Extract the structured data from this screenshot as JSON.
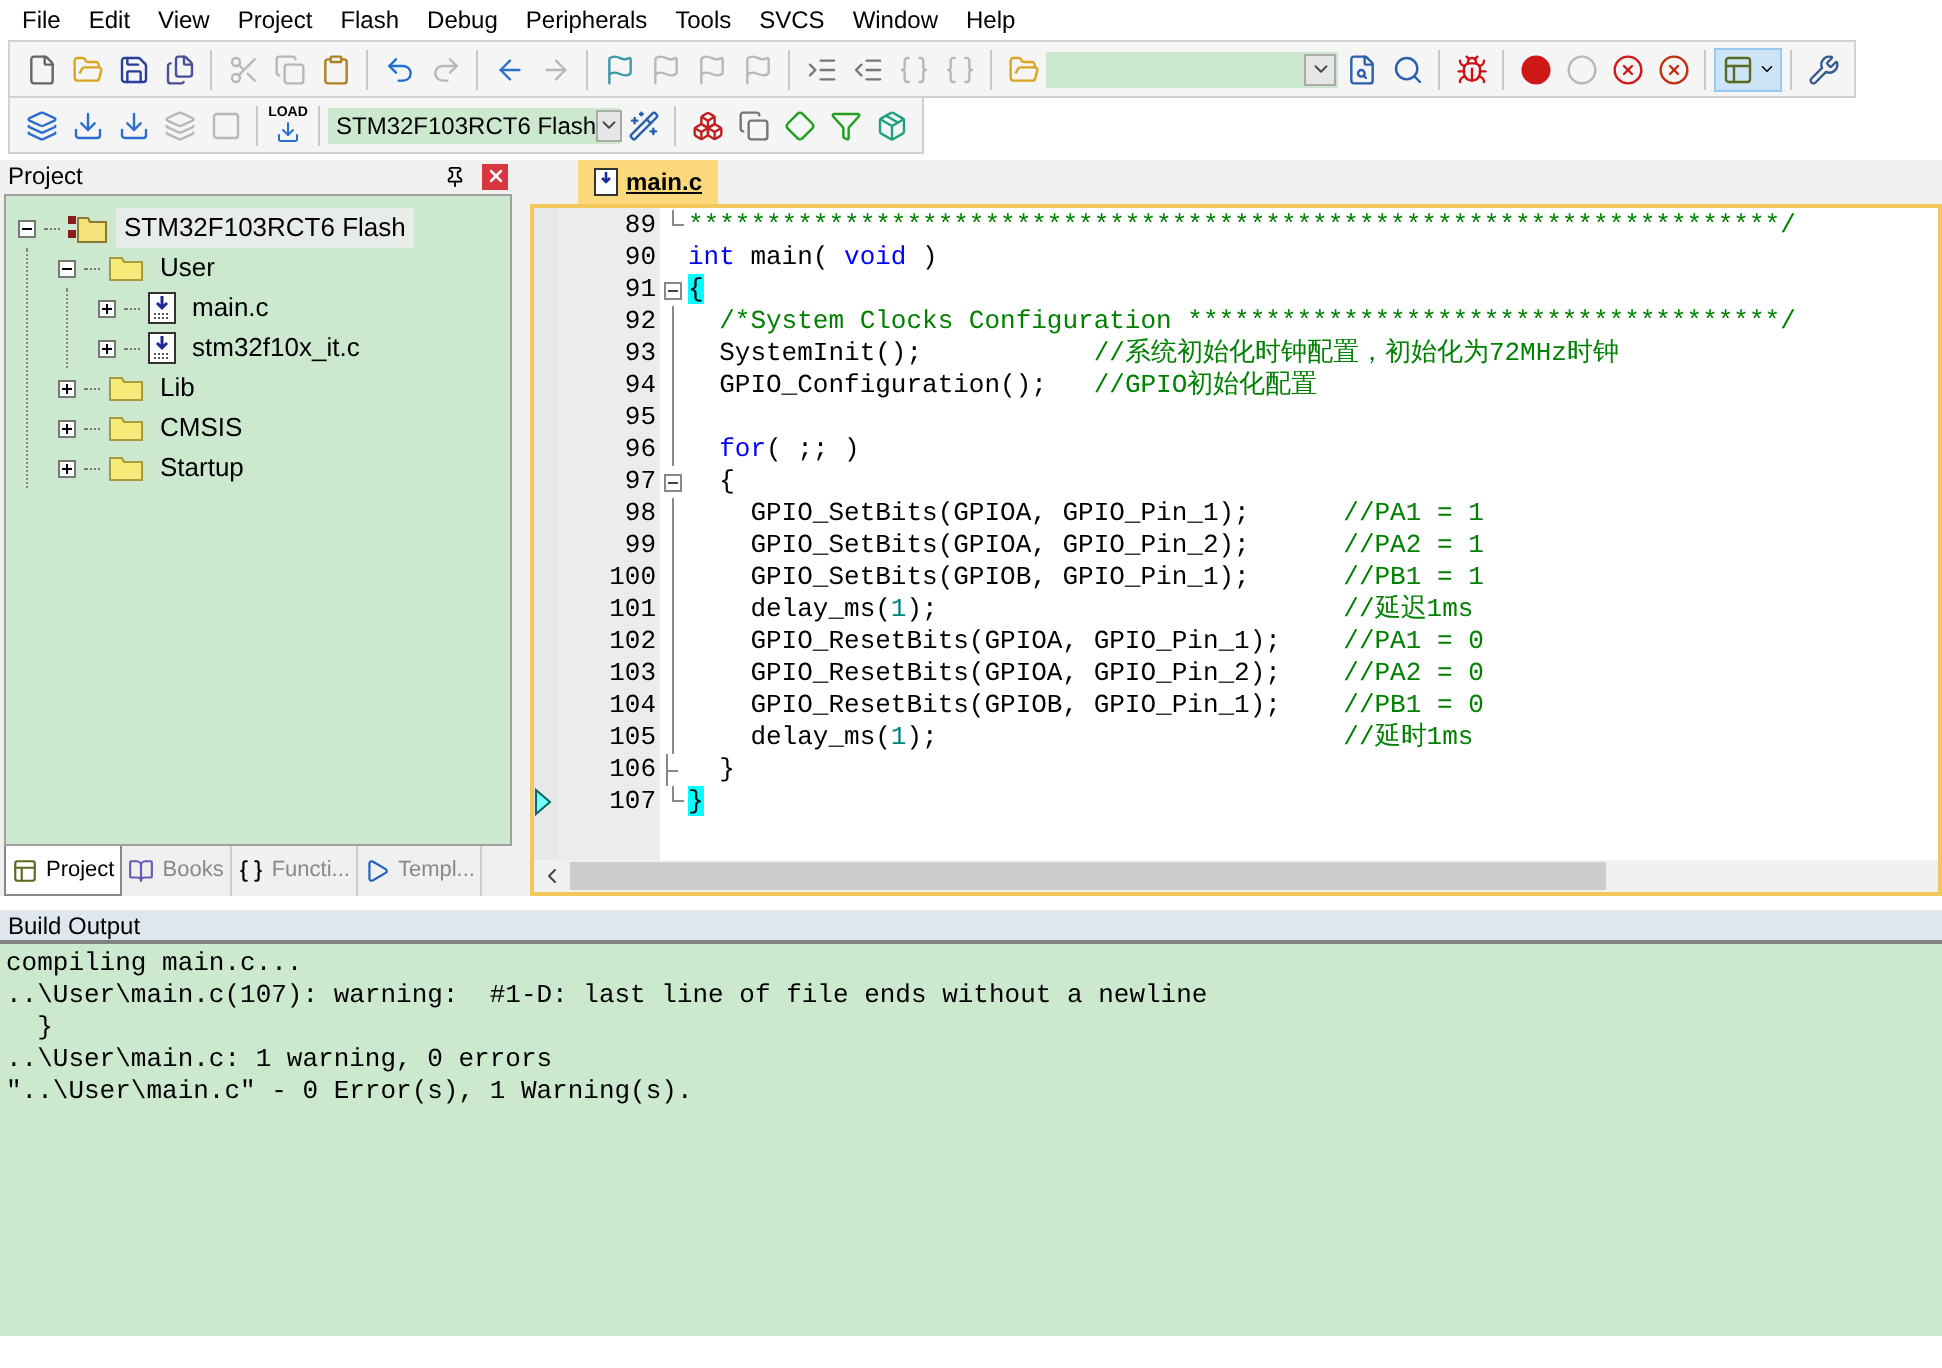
{
  "menu": [
    "File",
    "Edit",
    "View",
    "Project",
    "Flash",
    "Debug",
    "Peripherals",
    "Tools",
    "SVCS",
    "Window",
    "Help"
  ],
  "toolbar_1": [
    {
      "kind": "new",
      "disabled": false
    },
    {
      "kind": "open",
      "disabled": false
    },
    {
      "kind": "save",
      "disabled": false
    },
    {
      "kind": "save_all",
      "disabled": false
    },
    {
      "kind": "separator"
    },
    {
      "kind": "cut",
      "disabled": true
    },
    {
      "kind": "copy",
      "disabled": true
    },
    {
      "kind": "paste",
      "disabled": false
    },
    {
      "kind": "separator"
    },
    {
      "kind": "undo",
      "disabled": false
    },
    {
      "kind": "redo",
      "disabled": true
    },
    {
      "kind": "separator"
    },
    {
      "kind": "back",
      "disabled": false
    },
    {
      "kind": "forward",
      "disabled": true
    },
    {
      "kind": "separator"
    },
    {
      "kind": "bookmark",
      "disabled": false
    },
    {
      "kind": "prev_bookmark",
      "disabled": true
    },
    {
      "kind": "next_bookmark",
      "disabled": true
    },
    {
      "kind": "clear_bookmarks",
      "disabled": true
    },
    {
      "kind": "separator"
    },
    {
      "kind": "indent",
      "disabled": false
    },
    {
      "kind": "unindent",
      "disabled": false
    },
    {
      "kind": "comment",
      "disabled": true
    },
    {
      "kind": "uncomment",
      "disabled": true
    },
    {
      "kind": "separator"
    },
    {
      "kind": "find_in_files",
      "disabled": false
    },
    {
      "kind": "find_combo"
    },
    {
      "kind": "find",
      "disabled": false
    },
    {
      "kind": "incremental_find",
      "disabled": false
    },
    {
      "kind": "separator"
    },
    {
      "kind": "debug",
      "disabled": false
    },
    {
      "kind": "separator"
    },
    {
      "kind": "breakpoint",
      "disabled": false
    },
    {
      "kind": "disable_breakpoint",
      "disabled": true
    },
    {
      "kind": "disable_all",
      "disabled": false
    },
    {
      "kind": "kill_all",
      "disabled": false
    },
    {
      "kind": "separator"
    },
    {
      "kind": "window",
      "disabled": false
    },
    {
      "kind": "separator"
    },
    {
      "kind": "configure",
      "disabled": false
    }
  ],
  "toolbar_2": [
    {
      "kind": "translate",
      "disabled": false
    },
    {
      "kind": "build",
      "disabled": false
    },
    {
      "kind": "rebuild",
      "disabled": false
    },
    {
      "kind": "batch",
      "disabled": true
    },
    {
      "kind": "stop",
      "disabled": true
    },
    {
      "kind": "separator"
    },
    {
      "kind": "load",
      "disabled": false,
      "label": "LOAD"
    },
    {
      "kind": "separator"
    },
    {
      "kind": "target_combo",
      "value": "STM32F103RCT6 Flash"
    },
    {
      "kind": "options",
      "disabled": false
    },
    {
      "kind": "separator"
    },
    {
      "kind": "components",
      "disabled": false
    },
    {
      "kind": "environment",
      "disabled": false
    },
    {
      "kind": "packs",
      "disabled": false
    },
    {
      "kind": "filter",
      "disabled": false
    },
    {
      "kind": "multi",
      "disabled": false
    }
  ],
  "project_panel": {
    "title": "Project",
    "tree": [
      {
        "label": "STM32F103RCT6 Flash",
        "kind": "target",
        "expanded": true,
        "selected": true,
        "children": [
          {
            "label": "User",
            "kind": "folder",
            "expanded": true,
            "selected": false,
            "children": [
              {
                "label": "main.c",
                "kind": "file",
                "expanded": false,
                "selected": false
              },
              {
                "label": "stm32f10x_it.c",
                "kind": "file",
                "expanded": false,
                "selected": false
              }
            ]
          },
          {
            "label": "Lib",
            "kind": "folder",
            "expanded": false,
            "selected": false
          },
          {
            "label": "CMSIS",
            "kind": "folder",
            "expanded": false,
            "selected": false
          },
          {
            "label": "Startup",
            "kind": "folder",
            "expanded": false,
            "selected": false
          }
        ]
      }
    ],
    "tabs": [
      {
        "label": "Project",
        "kind": "project",
        "selected": true
      },
      {
        "label": "Books",
        "kind": "books",
        "selected": false
      },
      {
        "label": "Functi...",
        "kind": "functions",
        "selected": false
      },
      {
        "label": "Templ...",
        "kind": "templates",
        "selected": false
      }
    ]
  },
  "editor": {
    "tabs": [
      {
        "label": "main.c",
        "selected": true
      }
    ],
    "lines": [
      {
        "no": "89",
        "fold": {
          "kind": "end"
        },
        "current": false,
        "segments": [
          {
            "kind": "comment",
            "text": "**********************************************************************/"
          }
        ]
      },
      {
        "no": "90",
        "fold": {
          "kind": "none"
        },
        "current": false,
        "segments": [
          {
            "kind": "keyword",
            "text": "int"
          },
          {
            "kind": "plain",
            "text": " main( "
          },
          {
            "kind": "keyword",
            "text": "void"
          },
          {
            "kind": "plain",
            "text": " )"
          }
        ]
      },
      {
        "no": "91",
        "fold": {
          "kind": "open"
        },
        "current": false,
        "segments": [
          {
            "kind": "brace_match",
            "text": "{"
          }
        ]
      },
      {
        "no": "92",
        "fold": {
          "kind": "line"
        },
        "current": false,
        "segments": [
          {
            "kind": "comment",
            "text": "  /*System Clocks Configuration **************************************/"
          }
        ]
      },
      {
        "no": "93",
        "fold": {
          "kind": "line"
        },
        "current": false,
        "segments": [
          {
            "kind": "plain",
            "text": "  SystemInit();           "
          },
          {
            "kind": "comment",
            "text": "//系统初始化时钟配置，初始化为72MHz时钟"
          }
        ]
      },
      {
        "no": "94",
        "fold": {
          "kind": "line"
        },
        "current": false,
        "segments": [
          {
            "kind": "plain",
            "text": "  GPIO_Configuration();   "
          },
          {
            "kind": "comment",
            "text": "//GPIO初始化配置"
          }
        ]
      },
      {
        "no": "95",
        "fold": {
          "kind": "line"
        },
        "current": false
      },
      {
        "no": "96",
        "fold": {
          "kind": "line"
        },
        "current": false,
        "segments": [
          {
            "kind": "keyword",
            "text": "  for"
          },
          {
            "kind": "plain",
            "text": "( ;; )"
          }
        ]
      },
      {
        "no": "97",
        "fold": {
          "kind": "open"
        },
        "current": false,
        "segments": [
          {
            "kind": "plain",
            "text": "  {"
          }
        ]
      },
      {
        "no": "98",
        "fold": {
          "kind": "line"
        },
        "current": false,
        "segments": [
          {
            "kind": "plain",
            "text": "    GPIO_SetBits(GPIOA, GPIO_Pin_1);      "
          },
          {
            "kind": "comment",
            "text": "//PA1 = 1"
          }
        ]
      },
      {
        "no": "99",
        "fold": {
          "kind": "line"
        },
        "current": false,
        "segments": [
          {
            "kind": "plain",
            "text": "    GPIO_SetBits(GPIOA, GPIO_Pin_2);      "
          },
          {
            "kind": "comment",
            "text": "//PA2 = 1"
          }
        ]
      },
      {
        "no": "100",
        "fold": {
          "kind": "line"
        },
        "current": false,
        "segments": [
          {
            "kind": "plain",
            "text": "    GPIO_SetBits(GPIOB, GPIO_Pin_1);      "
          },
          {
            "kind": "comment",
            "text": "//PB1 = 1"
          }
        ]
      },
      {
        "no": "101",
        "fold": {
          "kind": "line"
        },
        "current": false,
        "segments": [
          {
            "kind": "plain",
            "text": "    delay_ms("
          },
          {
            "kind": "number",
            "text": "1"
          },
          {
            "kind": "plain",
            "text": ");                          "
          },
          {
            "kind": "comment",
            "text": "//延迟1ms"
          }
        ]
      },
      {
        "no": "102",
        "fold": {
          "kind": "line"
        },
        "current": false,
        "segments": [
          {
            "kind": "plain",
            "text": "    GPIO_ResetBits(GPIOA, GPIO_Pin_1);    "
          },
          {
            "kind": "comment",
            "text": "//PA1 = 0"
          }
        ]
      },
      {
        "no": "103",
        "fold": {
          "kind": "line"
        },
        "current": false,
        "segments": [
          {
            "kind": "plain",
            "text": "    GPIO_ResetBits(GPIOA, GPIO_Pin_2);    "
          },
          {
            "kind": "comment",
            "text": "//PA2 = 0"
          }
        ]
      },
      {
        "no": "104",
        "fold": {
          "kind": "line"
        },
        "current": false,
        "segments": [
          {
            "kind": "plain",
            "text": "    GPIO_ResetBits(GPIOB, GPIO_Pin_1);    "
          },
          {
            "kind": "comment",
            "text": "//PB1 = 0"
          }
        ]
      },
      {
        "no": "105",
        "fold": {
          "kind": "line"
        },
        "current": false,
        "segments": [
          {
            "kind": "plain",
            "text": "    delay_ms("
          },
          {
            "kind": "number",
            "text": "1"
          },
          {
            "kind": "plain",
            "text": ");                          "
          },
          {
            "kind": "comment",
            "text": "//延时1ms"
          }
        ]
      },
      {
        "no": "106",
        "fold": {
          "kind": "branch_end"
        },
        "current": false,
        "segments": [
          {
            "kind": "plain",
            "text": "  }"
          }
        ]
      },
      {
        "no": "107",
        "fold": {
          "kind": "end"
        },
        "current": true,
        "segments": [
          {
            "kind": "brace_match",
            "text": "}"
          }
        ]
      }
    ]
  },
  "build_output": {
    "title": "Build Output",
    "lines": [
      "compiling main.c...",
      "..\\User\\main.c(107): warning:  #1-D: last line of file ends without a newline",
      "  }",
      "..\\User\\main.c: 1 warning, 0 errors",
      "\"..\\User\\main.c\" - 0 Error(s), 1 Warning(s)."
    ]
  }
}
